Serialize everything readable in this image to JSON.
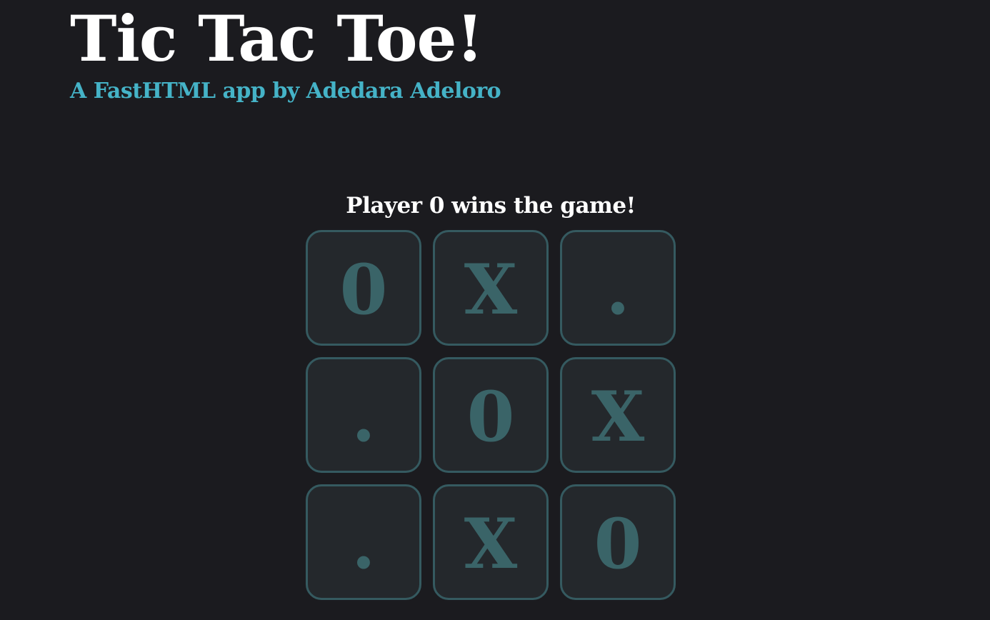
{
  "header": {
    "title": "Tic Tac Toe!",
    "subtitle": "A FastHTML app by Adedara Adeloro"
  },
  "game": {
    "status": "Player 0 wins the game!",
    "board": [
      [
        "0",
        "X",
        "."
      ],
      [
        ".",
        "0",
        "X"
      ],
      [
        ".",
        "X",
        "0"
      ]
    ]
  }
}
